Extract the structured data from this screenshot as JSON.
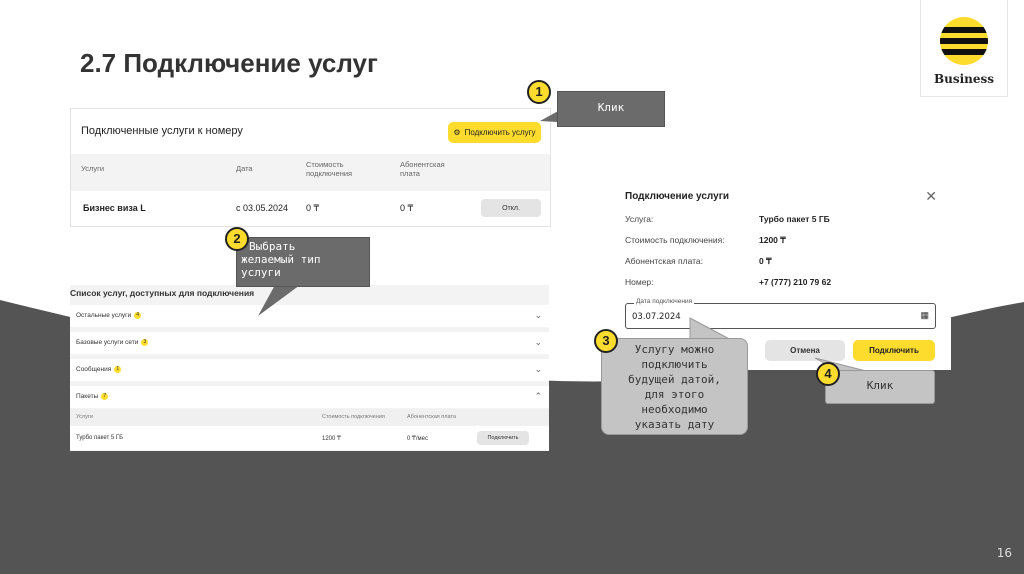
{
  "slide": {
    "title": "2.7  Подключение услуг",
    "brand": "Business",
    "page_number": "16"
  },
  "connected_panel": {
    "header": "Подключенные услуги к номеру",
    "connect_button": "Подключить услугу",
    "columns": [
      "Услуги",
      "Дата",
      "Стоимость подключения",
      "Абонентская плата"
    ],
    "row": {
      "service": "Бизнес виза L",
      "date": "с 03.05.2024",
      "cost": "0 ₸",
      "fee": "0 ₸",
      "action": "Откл."
    }
  },
  "available_panel": {
    "header": "Список услуг, доступных для подключения",
    "groups": [
      {
        "label": "Остальные услуги",
        "count": "4"
      },
      {
        "label": "Базовые услуги сети",
        "count": "3"
      },
      {
        "label": "Сообщения",
        "count": "1"
      },
      {
        "label": "Пакеты",
        "count": "7"
      }
    ],
    "columns": [
      "Услуги",
      "Стоимость подключения",
      "Абонентская плата"
    ],
    "row": {
      "service": "Турбо пакет 5 ГБ",
      "cost": "1200 ₸",
      "fee": "0 ₸/мес",
      "action": "Подключить"
    }
  },
  "modal": {
    "title": "Подключение услуги",
    "fields": [
      {
        "label": "Услуга:",
        "value": "Турбо пакет 5 ГБ"
      },
      {
        "label": "Стоимость подключения:",
        "value": "1200 ₸"
      },
      {
        "label": "Абонентская плата:",
        "value": "0 ₸"
      },
      {
        "label": "Номер:",
        "value": "+7 (777) 210 79 62"
      }
    ],
    "date_label": "Дата подключения",
    "date_value": "03.07.2024",
    "cancel": "Отмена",
    "confirm": "Подключить"
  },
  "callouts": {
    "c1_num": "1",
    "c1_text": "Клик",
    "c2_num": "2",
    "c2_l1": "Выбрать",
    "c2_l2": "желаемый тип",
    "c2_l3": "услуги",
    "c3_num": "3",
    "c3_l1": "Услугу можно",
    "c3_l2": "подключить",
    "c3_l3": "будущей датой,",
    "c3_l4": "для этого",
    "c3_l5": "необходимо",
    "c3_l6": "указать дату",
    "c4_num": "4",
    "c4_text": "Клик"
  },
  "colors": {
    "brand_yellow": "#fddc2e",
    "dark_band": "#545454",
    "callout_dark": "#6b6b6b",
    "callout_light": "#c4c4c4"
  }
}
